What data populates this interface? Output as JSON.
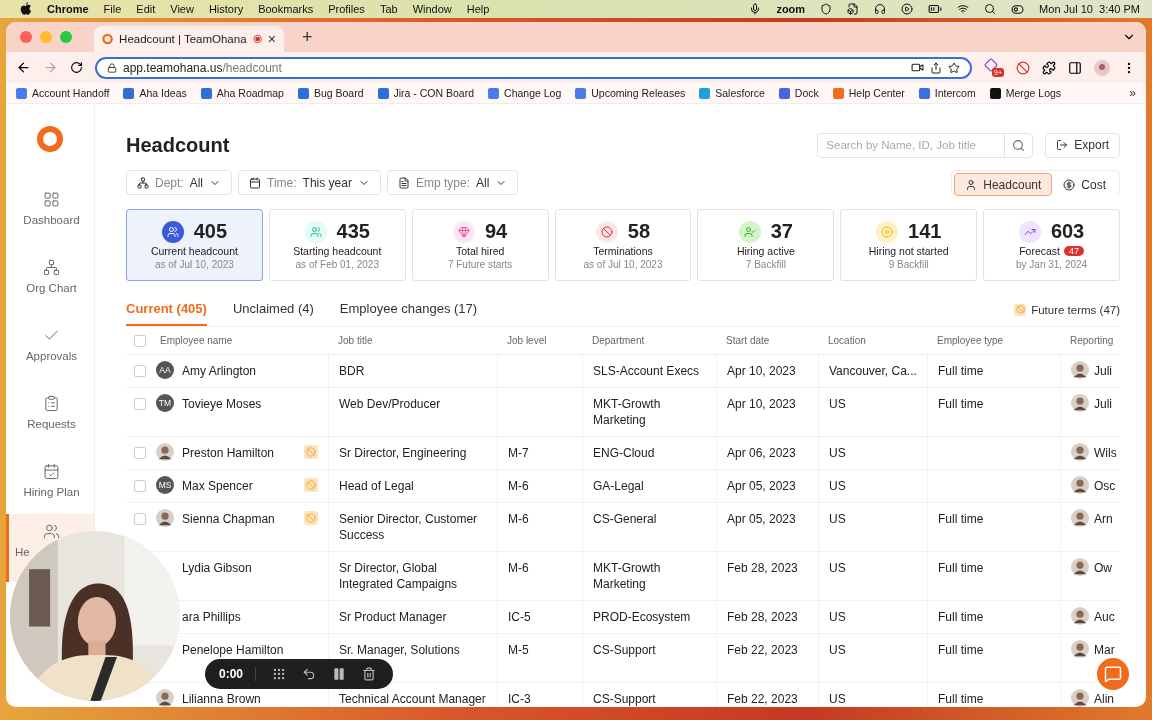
{
  "menu_bar": {
    "app": "Chrome",
    "items": [
      "File",
      "Edit",
      "View",
      "History",
      "Bookmarks",
      "Profiles",
      "Tab",
      "Window",
      "Help"
    ],
    "zoom": "zoom",
    "clock": "Mon Jul 10  3:40 PM"
  },
  "browser": {
    "tab_title": "Headcount | TeamOhana",
    "tab_close": "×",
    "new_tab": "+",
    "url_host": "app.teamohana.us",
    "url_path": "/headcount",
    "extension_badge": "9+",
    "bookmarks": [
      {
        "label": "Account Handoff",
        "color": "#4a7bea"
      },
      {
        "label": "Aha Ideas",
        "color": "#2f6fd6"
      },
      {
        "label": "Aha Roadmap",
        "color": "#2f6fd6"
      },
      {
        "label": "Bug Board",
        "color": "#2a6fdb"
      },
      {
        "label": "Jira - CON Board",
        "color": "#2a6fdb"
      },
      {
        "label": "Change Log",
        "color": "#4a7bea"
      },
      {
        "label": "Upcoming Releases",
        "color": "#4a7bea"
      },
      {
        "label": "Salesforce",
        "color": "#1ea0e0"
      },
      {
        "label": "Dock",
        "color": "#4b63e0"
      },
      {
        "label": "Help Center",
        "color": "#f26b1d"
      },
      {
        "label": "Intercom",
        "color": "#3a6fe0"
      },
      {
        "label": "Merge Logs",
        "color": "#111111"
      }
    ],
    "bookmarks_more": "»"
  },
  "sidebar": {
    "items": [
      {
        "kind": "dashboard",
        "label": "Dashboard",
        "selected": false
      },
      {
        "kind": "org",
        "label": "Org Chart",
        "selected": false
      },
      {
        "kind": "approvals",
        "label": "Approvals",
        "selected": false
      },
      {
        "kind": "requests",
        "label": "Requests",
        "selected": false
      },
      {
        "kind": "hiring",
        "label": "Hiring Plan",
        "selected": false
      },
      {
        "kind": "headcount",
        "label": "He",
        "selected": true
      }
    ]
  },
  "page": {
    "title": "Headcount",
    "search": {
      "placeholder": "Search by Name, ID, Job title"
    },
    "export": "Export",
    "filters": [
      {
        "kind": "dept",
        "label": "Dept:",
        "value": "All"
      },
      {
        "kind": "time",
        "label": "Time:",
        "value": "This year"
      },
      {
        "kind": "type",
        "label": "Emp type:",
        "value": "All"
      }
    ],
    "view_toggle": [
      {
        "kind": "headcount",
        "label": "Headcount",
        "selected": true
      },
      {
        "kind": "cost",
        "label": "Cost",
        "selected": false
      }
    ]
  },
  "stats": [
    {
      "kind": "current",
      "value": "405",
      "label": "Current headcount",
      "sub": "as of Jul 10, 2023",
      "selected": true
    },
    {
      "kind": "starting",
      "value": "435",
      "label": "Starting headcount",
      "sub": "as of Feb 01, 2023",
      "selected": false
    },
    {
      "kind": "hired",
      "value": "94",
      "label": "Total hired",
      "sub": "7 Future starts",
      "selected": false
    },
    {
      "kind": "terminations",
      "value": "58",
      "label": "Terminations",
      "sub": "as of Jul 10, 2023",
      "selected": false
    },
    {
      "kind": "active",
      "value": "37",
      "label": "Hiring active",
      "sub": "7 Backfill",
      "selected": false
    },
    {
      "kind": "notstarted",
      "value": "141",
      "label": "Hiring not started",
      "sub": "9 Backfill",
      "selected": false
    },
    {
      "kind": "forecast",
      "value": "603",
      "label": "Forecast",
      "badge": "47",
      "sub": "by Jan 31, 2024",
      "selected": false
    }
  ],
  "tabs": [
    {
      "label": "Current (405)",
      "selected": true
    },
    {
      "label": "Unclaimed (4)",
      "selected": false
    },
    {
      "label": "Employee changes (17)",
      "selected": false
    }
  ],
  "future_terms": "Future terms (47)",
  "table": {
    "all_checked": false,
    "columns": [
      "Employee name",
      "Job title",
      "Job level",
      "Department",
      "Start date",
      "Location",
      "Employee type",
      "Reporting"
    ],
    "rows": [
      {
        "checked": false,
        "photo": false,
        "initials": "AA",
        "name": "Amy Arlington",
        "term": false,
        "title": "BDR",
        "department": "SLS-Account Execs",
        "start": "Apr 10, 2023",
        "location": "Vancouver, Ca...",
        "type": "Full time",
        "manager": "Juli"
      },
      {
        "checked": false,
        "photo": false,
        "initials": "TM",
        "name": "Tovieye Moses",
        "term": false,
        "title": "Web Dev/Producer",
        "department": "MKT-Growth Marketing",
        "start": "Apr 10, 2023",
        "location": "US",
        "type": "Full time",
        "manager": "Juli"
      },
      {
        "checked": false,
        "photo": true,
        "name": "Preston Hamilton",
        "term": true,
        "title": "Sr Director, Engineering",
        "level": "M-7",
        "department": "ENG-Cloud",
        "start": "Apr 06, 2023",
        "location": "US",
        "manager": "Wils"
      },
      {
        "checked": false,
        "photo": false,
        "initials": "MS",
        "name": "Max Spencer",
        "term": true,
        "title": "Head of Legal",
        "level": "M-6",
        "department": "GA-Legal",
        "start": "Apr 05, 2023",
        "location": "US",
        "manager": "Osc"
      },
      {
        "checked": false,
        "photo": true,
        "name": "Sienna Chapman",
        "term": true,
        "title": "Senior Director, Customer Success",
        "level": "M-6",
        "department": "CS-General",
        "start": "Apr 05, 2023",
        "location": "US",
        "type": "Full time",
        "manager": "Arn"
      },
      {
        "name": "Lydia Gibson",
        "term": false,
        "title": "Sr Director, Global Integrated Campaigns",
        "level": "M-6",
        "department": "MKT-Growth Marketing",
        "start": "Feb 28, 2023",
        "location": "US",
        "type": "Full time",
        "manager": "Ow"
      },
      {
        "name": "ara Phillips",
        "term": false,
        "title": "Sr Product Manager",
        "level": "IC-5",
        "department": "PROD-Ecosystem",
        "start": "Feb 28, 2023",
        "location": "US",
        "type": "Full time",
        "manager": "Auc"
      },
      {
        "name": "Penelope Hamilton",
        "term": false,
        "title": "Sr. Manager, Solutions",
        "level": "M-5",
        "department": "CS-Support",
        "start": "Feb 22, 2023",
        "location": "US",
        "type": "Full time",
        "manager": "Mar"
      },
      {
        "photo": true,
        "name": "Lilianna Brown",
        "term": false,
        "title": "Technical Account Manager",
        "level": "IC-3",
        "department": "CS-Support",
        "start": "Feb 22, 2023",
        "location": "US",
        "type": "Full time",
        "manager": "Alin"
      }
    ]
  },
  "recorder": {
    "time": "0:00"
  }
}
